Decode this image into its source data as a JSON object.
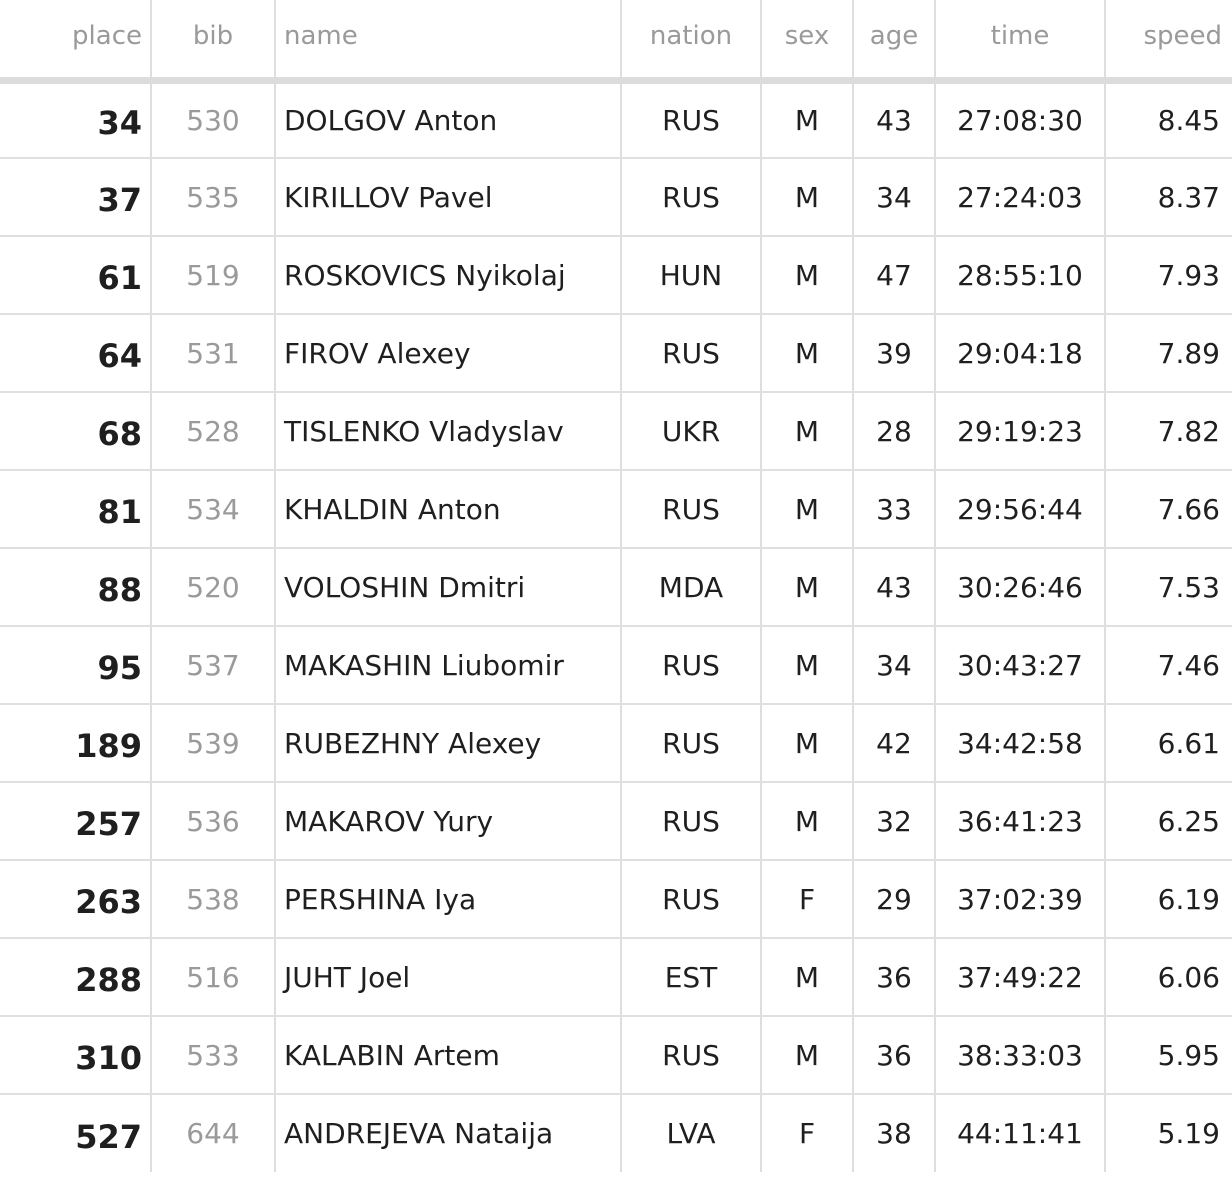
{
  "columns": {
    "place": "place",
    "bib": "bib",
    "name": "name",
    "nation": "nation",
    "sex": "sex",
    "age": "age",
    "time": "time",
    "speed": "speed"
  },
  "rows": [
    {
      "place": "34",
      "bib": "530",
      "name": "DOLGOV Anton",
      "nation": "RUS",
      "sex": "M",
      "age": "43",
      "time": "27:08:30",
      "speed": "8.45"
    },
    {
      "place": "37",
      "bib": "535",
      "name": "KIRILLOV Pavel",
      "nation": "RUS",
      "sex": "M",
      "age": "34",
      "time": "27:24:03",
      "speed": "8.37"
    },
    {
      "place": "61",
      "bib": "519",
      "name": "ROSKOVICS Nyikolaj",
      "nation": "HUN",
      "sex": "M",
      "age": "47",
      "time": "28:55:10",
      "speed": "7.93"
    },
    {
      "place": "64",
      "bib": "531",
      "name": "FIROV Alexey",
      "nation": "RUS",
      "sex": "M",
      "age": "39",
      "time": "29:04:18",
      "speed": "7.89"
    },
    {
      "place": "68",
      "bib": "528",
      "name": "TISLENKO Vladyslav",
      "nation": "UKR",
      "sex": "M",
      "age": "28",
      "time": "29:19:23",
      "speed": "7.82"
    },
    {
      "place": "81",
      "bib": "534",
      "name": "KHALDIN Anton",
      "nation": "RUS",
      "sex": "M",
      "age": "33",
      "time": "29:56:44",
      "speed": "7.66"
    },
    {
      "place": "88",
      "bib": "520",
      "name": "VOLOSHIN Dmitri",
      "nation": "MDA",
      "sex": "M",
      "age": "43",
      "time": "30:26:46",
      "speed": "7.53"
    },
    {
      "place": "95",
      "bib": "537",
      "name": "MAKASHIN Liubomir",
      "nation": "RUS",
      "sex": "M",
      "age": "34",
      "time": "30:43:27",
      "speed": "7.46"
    },
    {
      "place": "189",
      "bib": "539",
      "name": "RUBEZHNY Alexey",
      "nation": "RUS",
      "sex": "M",
      "age": "42",
      "time": "34:42:58",
      "speed": "6.61"
    },
    {
      "place": "257",
      "bib": "536",
      "name": "MAKAROV Yury",
      "nation": "RUS",
      "sex": "M",
      "age": "32",
      "time": "36:41:23",
      "speed": "6.25"
    },
    {
      "place": "263",
      "bib": "538",
      "name": "PERSHINA Iya",
      "nation": "RUS",
      "sex": "F",
      "age": "29",
      "time": "37:02:39",
      "speed": "6.19"
    },
    {
      "place": "288",
      "bib": "516",
      "name": "JUHT Joel",
      "nation": "EST",
      "sex": "M",
      "age": "36",
      "time": "37:49:22",
      "speed": "6.06"
    },
    {
      "place": "310",
      "bib": "533",
      "name": "KALABIN Artem",
      "nation": "RUS",
      "sex": "M",
      "age": "36",
      "time": "38:33:03",
      "speed": "5.95"
    },
    {
      "place": "527",
      "bib": "644",
      "name": "ANDREJEVA Nataija",
      "nation": "LVA",
      "sex": "F",
      "age": "38",
      "time": "44:11:41",
      "speed": "5.19"
    }
  ]
}
